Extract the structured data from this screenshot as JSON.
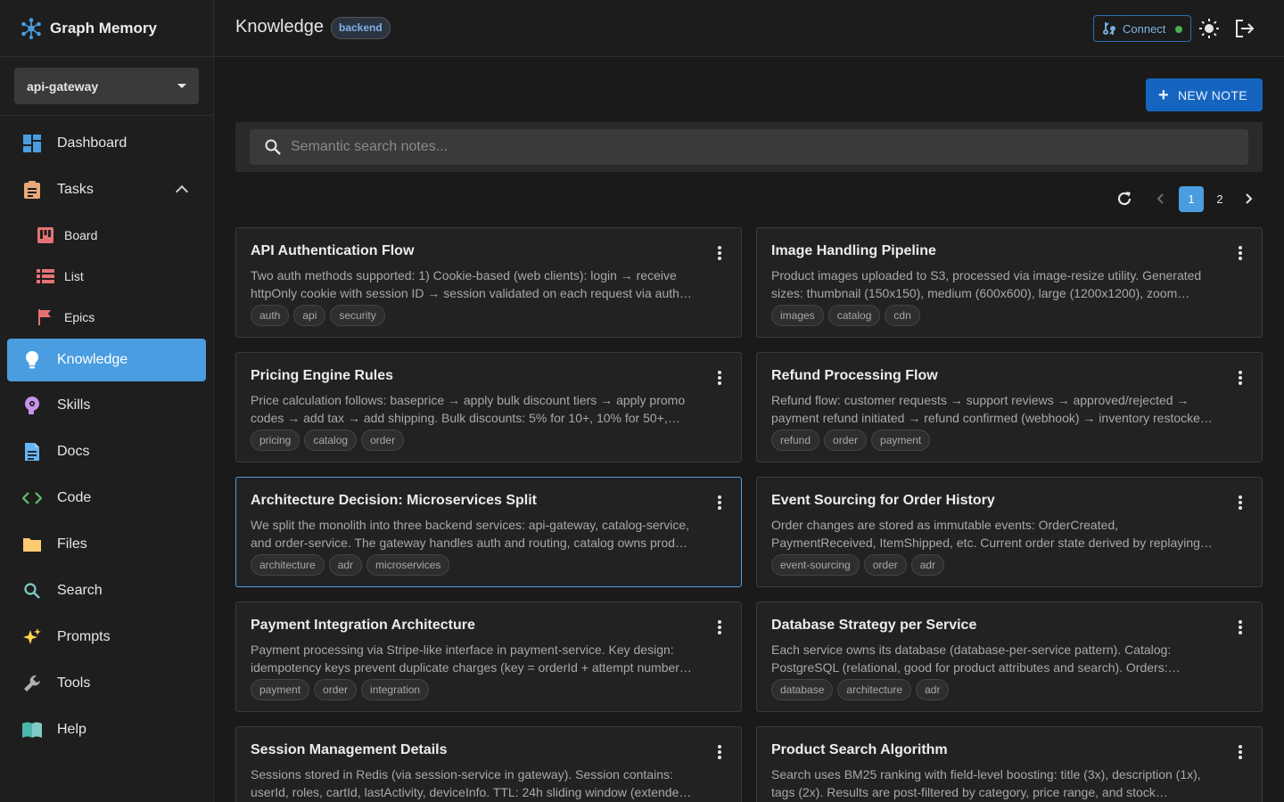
{
  "app": {
    "name": "Graph Memory"
  },
  "project": {
    "selected": "api-gateway"
  },
  "nav": {
    "dashboard": "Dashboard",
    "tasks": "Tasks",
    "board": "Board",
    "list": "List",
    "epics": "Epics",
    "knowledge": "Knowledge",
    "skills": "Skills",
    "docs": "Docs",
    "code": "Code",
    "files": "Files",
    "search": "Search",
    "prompts": "Prompts",
    "tools": "Tools",
    "help": "Help"
  },
  "header": {
    "title": "Knowledge",
    "badge": "backend",
    "connect_label": "Connect",
    "connect_status_color": "#4caf50"
  },
  "toolbar": {
    "new_note_label": "NEW NOTE",
    "search_placeholder": "Semantic search notes..."
  },
  "pagination": {
    "current": "1",
    "pages": [
      "1",
      "2"
    ]
  },
  "colors": {
    "accent": "#4a9de0",
    "primary_button": "#1565c0"
  },
  "notes": [
    {
      "title": "API Authentication Flow",
      "desc": "Two auth methods supported: 1) Cookie-based (web clients): login → receive httpOnly cookie with session ID → session validated on each request via auth…",
      "tags": [
        "auth",
        "api",
        "security"
      ]
    },
    {
      "title": "Image Handling Pipeline",
      "desc": "Product images uploaded to S3, processed via image-resize utility. Generated sizes: thumbnail (150x150), medium (600x600), large (1200x1200), zoom…",
      "tags": [
        "images",
        "catalog",
        "cdn"
      ]
    },
    {
      "title": "Pricing Engine Rules",
      "desc": "Price calculation follows: baseprice → apply bulk discount tiers → apply promo codes → add tax → add shipping. Bulk discounts: 5% for 10+, 10% for 50+,…",
      "tags": [
        "pricing",
        "catalog",
        "order"
      ]
    },
    {
      "title": "Refund Processing Flow",
      "desc": "Refund flow: customer requests → support reviews → approved/rejected → payment refund initiated → refund confirmed (webhook) → inventory restocke…",
      "tags": [
        "refund",
        "order",
        "payment"
      ]
    },
    {
      "title": "Architecture Decision: Microservices Split",
      "desc": "We split the monolith into three backend services: api-gateway, catalog-service, and order-service. The gateway handles auth and routing, catalog owns prod…",
      "tags": [
        "architecture",
        "adr",
        "microservices"
      ]
    },
    {
      "title": "Event Sourcing for Order History",
      "desc": "Order changes are stored as immutable events: OrderCreated, PaymentReceived, ItemShipped, etc. Current order state derived by replaying…",
      "tags": [
        "event-sourcing",
        "order",
        "adr"
      ]
    },
    {
      "title": "Payment Integration Architecture",
      "desc": "Payment processing via Stripe-like interface in payment-service. Key design: idempotency keys prevent duplicate charges (key = orderId + attempt number…",
      "tags": [
        "payment",
        "order",
        "integration"
      ]
    },
    {
      "title": "Database Strategy per Service",
      "desc": "Each service owns its database (database-per-service pattern). Catalog: PostgreSQL (relational, good for product attributes and search). Orders:…",
      "tags": [
        "database",
        "architecture",
        "adr"
      ]
    },
    {
      "title": "Session Management Details",
      "desc": "Sessions stored in Redis (via session-service in gateway). Session contains: userId, roles, cartId, lastActivity, deviceInfo. TTL: 24h sliding window (extende…",
      "tags": []
    },
    {
      "title": "Product Search Algorithm",
      "desc": "Search uses BM25 ranking with field-level boosting: title (3x), description (1x), tags (2x). Results are post-filtered by category, price range, and stock…",
      "tags": []
    }
  ]
}
